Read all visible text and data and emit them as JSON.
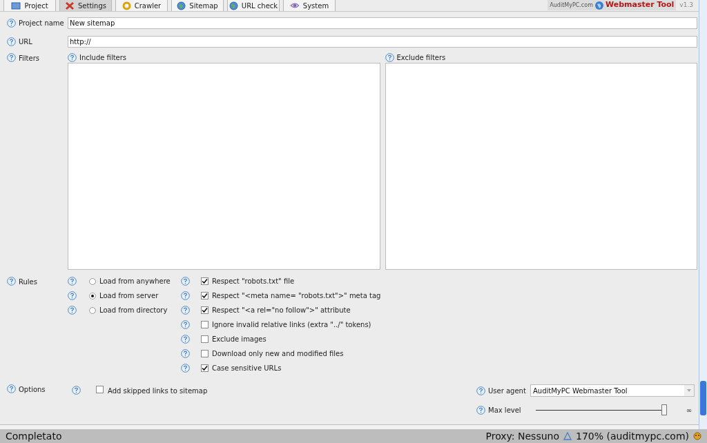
{
  "tabs": [
    {
      "label": "Project",
      "selected": false
    },
    {
      "label": "Settings",
      "selected": true
    },
    {
      "label": "Crawler",
      "selected": false
    },
    {
      "label": "Sitemap",
      "selected": false
    },
    {
      "label": "URL check",
      "selected": false
    },
    {
      "label": "System",
      "selected": false
    }
  ],
  "brand": {
    "site": "AuditMyPC.com",
    "name": "Webmaster Tool",
    "version": "v1.3"
  },
  "project_name": {
    "label": "Project name",
    "value": "New sitemap"
  },
  "url": {
    "label": "URL",
    "value": "http://"
  },
  "filters": {
    "label": "Filters",
    "include": "Include filters",
    "exclude": "Exclude filters"
  },
  "rules": {
    "label": "Rules",
    "sources": [
      {
        "label": "Load from anywhere",
        "selected": false
      },
      {
        "label": "Load from server",
        "selected": true
      },
      {
        "label": "Load from directory",
        "selected": false
      }
    ],
    "checks": [
      {
        "label": "Respect \"robots.txt\" file",
        "checked": true
      },
      {
        "label": "Respect \"<meta name= \"robots.txt\">\" meta tag",
        "checked": true
      },
      {
        "label": "Respect \"<a rel=\"no follow\">\" attribute",
        "checked": true
      },
      {
        "label": "Ignore invalid relative links (extra \"../\" tokens)",
        "checked": false
      },
      {
        "label": "Exclude images",
        "checked": false
      },
      {
        "label": "Download only new and modified files",
        "checked": false
      },
      {
        "label": "Case sensitive URLs",
        "checked": true
      }
    ]
  },
  "options": {
    "label": "Options",
    "add_skipped": {
      "label": "Add skipped links to sitemap",
      "checked": false
    },
    "user_agent": {
      "label": "User agent",
      "value": "AuditMyPC Webmaster Tool"
    },
    "max_level": {
      "label": "Max level",
      "level": 0.98,
      "reading": "∞"
    }
  },
  "status_bar": {
    "left": "Completato",
    "proxy": "Proxy: Nessuno",
    "zoom": "170% (auditmypc.com)"
  }
}
